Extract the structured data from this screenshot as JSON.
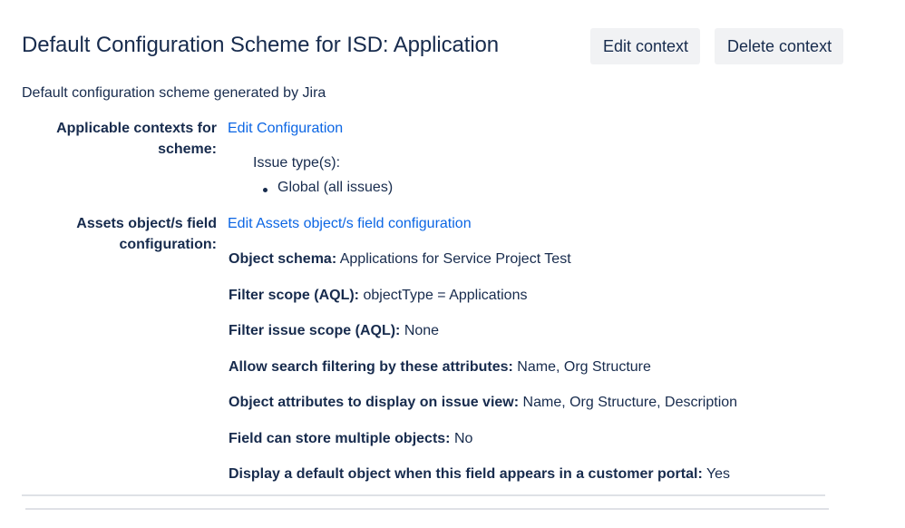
{
  "header": {
    "title": "Default Configuration Scheme for ISD: Application",
    "edit_context_label": "Edit context",
    "delete_context_label": "Delete context"
  },
  "description": "Default configuration scheme generated by Jira",
  "contexts": {
    "label": "Applicable contexts for scheme:",
    "link": "Edit Configuration",
    "issue_types_title": "Issue type(s):",
    "issue_types": [
      "Global (all issues)"
    ]
  },
  "assets": {
    "label": "Assets object/s field configuration:",
    "link": "Edit Assets object/s field configuration",
    "properties": [
      {
        "key": "Object schema:",
        "value": "Applications for Service Project Test"
      },
      {
        "key": "Filter scope (AQL):",
        "value": "objectType = Applications"
      },
      {
        "key": "Filter issue scope (AQL):",
        "value": "None"
      },
      {
        "key": "Allow search filtering by these attributes:",
        "value": "Name, Org Structure"
      },
      {
        "key": "Object attributes to display on issue view:",
        "value": "Name, Org Structure, Description"
      },
      {
        "key": "Field can store multiple objects:",
        "value": "No"
      },
      {
        "key": "Display a default object when this field appears in a customer portal:",
        "value": "Yes"
      }
    ]
  }
}
